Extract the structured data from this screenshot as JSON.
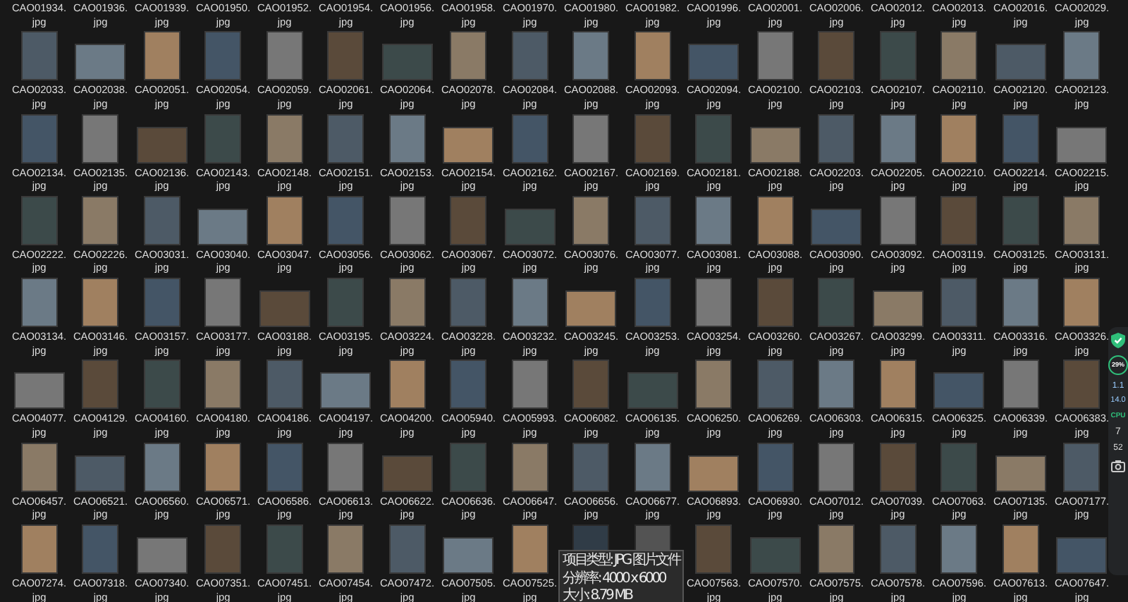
{
  "rows": [
    {
      "items": [
        {
          "name": "CAO01934.jpg"
        },
        {
          "name": "CAO01936.jpg"
        },
        {
          "name": "CAO01939.jpg"
        },
        {
          "name": "CAO01950.jpg"
        },
        {
          "name": "CAO01952.jpg"
        },
        {
          "name": "CAO01954.jpg"
        },
        {
          "name": "CAO01956.jpg"
        },
        {
          "name": "CAO01958.jpg"
        },
        {
          "name": "CAO01970.jpg"
        },
        {
          "name": "CAO01980.jpg"
        },
        {
          "name": "CAO01982.jpg"
        },
        {
          "name": "CAO01996.jpg"
        },
        {
          "name": "CAO02001.jpg"
        },
        {
          "name": "CAO02006.jpg"
        },
        {
          "name": "CAO02012.jpg"
        },
        {
          "name": "CAO02013.jpg"
        },
        {
          "name": "CAO02016.jpg"
        },
        {
          "name": "CAO02029.jpg"
        }
      ]
    },
    {
      "items": [
        {
          "name": "CAO02033.jpg"
        },
        {
          "name": "CAO02038.jpg"
        },
        {
          "name": "CAO02051.jpg"
        },
        {
          "name": "CAO02054.jpg"
        },
        {
          "name": "CAO02059.jpg"
        },
        {
          "name": "CAO02061.jpg"
        },
        {
          "name": "CAO02064.jpg"
        },
        {
          "name": "CAO02078.jpg"
        },
        {
          "name": "CAO02084.jpg"
        },
        {
          "name": "CAO02088.jpg"
        },
        {
          "name": "CAO02093.jpg"
        },
        {
          "name": "CAO02094.jpg"
        },
        {
          "name": "CAO02100.jpg"
        },
        {
          "name": "CAO02103.jpg"
        },
        {
          "name": "CAO02107.jpg"
        },
        {
          "name": "CAO02110.jpg"
        },
        {
          "name": "CAO02120.jpg"
        },
        {
          "name": "CAO02123.jpg"
        }
      ]
    },
    {
      "items": [
        {
          "name": "CAO02134.jpg"
        },
        {
          "name": "CAO02135.jpg"
        },
        {
          "name": "CAO02136.jpg"
        },
        {
          "name": "CAO02143.jpg"
        },
        {
          "name": "CAO02148.jpg"
        },
        {
          "name": "CAO02151.jpg"
        },
        {
          "name": "CAO02153.jpg"
        },
        {
          "name": "CAO02154.jpg"
        },
        {
          "name": "CAO02162.jpg"
        },
        {
          "name": "CAO02167.jpg"
        },
        {
          "name": "CAO02169.jpg"
        },
        {
          "name": "CAO02181.jpg"
        },
        {
          "name": "CAO02188.jpg"
        },
        {
          "name": "CAO02203.jpg"
        },
        {
          "name": "CAO02205.jpg"
        },
        {
          "name": "CAO02210.jpg"
        },
        {
          "name": "CAO02214.jpg"
        },
        {
          "name": "CAO02215.jpg"
        }
      ]
    },
    {
      "items": [
        {
          "name": "CAO02222.jpg"
        },
        {
          "name": "CAO02226.jpg"
        },
        {
          "name": "CAO03031.jpg"
        },
        {
          "name": "CAO03040.jpg"
        },
        {
          "name": "CAO03047.jpg"
        },
        {
          "name": "CAO03056.jpg"
        },
        {
          "name": "CAO03062.jpg"
        },
        {
          "name": "CAO03067.jpg"
        },
        {
          "name": "CAO03072.jpg"
        },
        {
          "name": "CAO03076.jpg"
        },
        {
          "name": "CAO03077.jpg"
        },
        {
          "name": "CAO03081.jpg"
        },
        {
          "name": "CAO03088.jpg"
        },
        {
          "name": "CAO03090.jpg"
        },
        {
          "name": "CAO03092.jpg"
        },
        {
          "name": "CAO03119.jpg"
        },
        {
          "name": "CAO03125.jpg"
        },
        {
          "name": "CAO03131.jpg"
        }
      ]
    },
    {
      "items": [
        {
          "name": "CAO03134.jpg"
        },
        {
          "name": "CAO03146.jpg"
        },
        {
          "name": "CAO03157.jpg"
        },
        {
          "name": "CAO03177.jpg"
        },
        {
          "name": "CAO03188.jpg"
        },
        {
          "name": "CAO03195.jpg"
        },
        {
          "name": "CAO03224.jpg"
        },
        {
          "name": "CAO03228.jpg"
        },
        {
          "name": "CAO03232.jpg"
        },
        {
          "name": "CAO03245.jpg"
        },
        {
          "name": "CAO03253.jpg"
        },
        {
          "name": "CAO03254.jpg"
        },
        {
          "name": "CAO03260.jpg"
        },
        {
          "name": "CAO03267.jpg"
        },
        {
          "name": "CAO03299.jpg"
        },
        {
          "name": "CAO03311.jpg"
        },
        {
          "name": "CAO03316.jpg"
        },
        {
          "name": "CAO03326.jpg"
        }
      ]
    },
    {
      "items": [
        {
          "name": "CAO04077.jpg"
        },
        {
          "name": "CAO04129.jpg"
        },
        {
          "name": "CAO04160.jpg"
        },
        {
          "name": "CAO04180.jpg"
        },
        {
          "name": "CAO04186.jpg"
        },
        {
          "name": "CAO04197.jpg"
        },
        {
          "name": "CAO04200.jpg"
        },
        {
          "name": "CAO05940.jpg"
        },
        {
          "name": "CAO05993.jpg"
        },
        {
          "name": "CAO06082.jpg"
        },
        {
          "name": "CAO06135.jpg"
        },
        {
          "name": "CAO06250.jpg"
        },
        {
          "name": "CAO06269.jpg"
        },
        {
          "name": "CAO06303.jpg"
        },
        {
          "name": "CAO06315.jpg"
        },
        {
          "name": "CAO06325.jpg"
        },
        {
          "name": "CAO06339.jpg"
        },
        {
          "name": "CAO06383.jpg"
        }
      ]
    },
    {
      "items": [
        {
          "name": "CAO06457.jpg"
        },
        {
          "name": "CAO06521.jpg"
        },
        {
          "name": "CAO06560.jpg"
        },
        {
          "name": "CAO06571.jpg"
        },
        {
          "name": "CAO06586.jpg"
        },
        {
          "name": "CAO06613.jpg"
        },
        {
          "name": "CAO06622.jpg"
        },
        {
          "name": "CAO06636.jpg"
        },
        {
          "name": "CAO06647.jpg"
        },
        {
          "name": "CAO06656.jpg"
        },
        {
          "name": "CAO06677.jpg"
        },
        {
          "name": "CAO06893.jpg"
        },
        {
          "name": "CAO06930.jpg"
        },
        {
          "name": "CAO07012.jpg"
        },
        {
          "name": "CAO07039.jpg"
        },
        {
          "name": "CAO07063.jpg"
        },
        {
          "name": "CAO07135.jpg"
        },
        {
          "name": "CAO07177.jpg"
        }
      ]
    },
    {
      "items": [
        {
          "name": "CAO07274.jpg"
        },
        {
          "name": "CAO07318.jpg"
        },
        {
          "name": "CAO07340.jpg"
        },
        {
          "name": "CAO07351.jpg"
        },
        {
          "name": "CAO07451.jpg"
        },
        {
          "name": "CAO07454.jpg"
        },
        {
          "name": "CAO07472.jpg"
        },
        {
          "name": "CAO07505.jpg"
        },
        {
          "name": "CAO07525.jpg"
        },
        {
          "kind": "covered"
        },
        {
          "kind": "covered"
        },
        {
          "name": "CAO07563.jpg"
        },
        {
          "name": "CAO07570.jpg"
        },
        {
          "name": "CAO07575.jpg"
        },
        {
          "name": "CAO07578.jpg"
        },
        {
          "name": "CAO07596.jpg"
        },
        {
          "name": "CAO07613.jpg"
        },
        {
          "name": "CAO07647.jpg"
        }
      ]
    }
  ],
  "tooltip": {
    "lines": [
      "项目类型: JPG 图片文件",
      "分辨率: 4000 x 6000",
      "大小: 8.79 MB"
    ]
  },
  "monitor": {
    "percent": "29%",
    "upload": "1.1",
    "download": "14.0",
    "cpu_label": "CPU",
    "cpu": "7",
    "temp": "52"
  }
}
